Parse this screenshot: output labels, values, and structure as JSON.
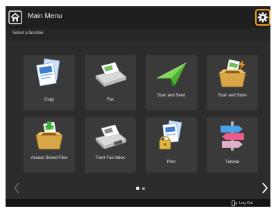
{
  "header": {
    "title": "Main Menu",
    "home_icon": "home-icon",
    "settings_icon": "gear-icon",
    "settings_highlight_color": "#f0a020"
  },
  "instruction": "Select a function.",
  "tiles": [
    {
      "label": "Copy",
      "icon": "copy-icon"
    },
    {
      "label": "Fax",
      "icon": "fax-icon"
    },
    {
      "label": "Scan and Send",
      "icon": "scan-and-send-icon"
    },
    {
      "label": "Scan and Store",
      "icon": "scan-and-store-icon"
    },
    {
      "label": "Access Stored Files",
      "icon": "access-stored-files-icon"
    },
    {
      "label": "Fax/I-Fax Inbox",
      "icon": "fax-inbox-icon"
    },
    {
      "label": "Print",
      "icon": "print-icon"
    },
    {
      "label": "Tutorial",
      "icon": "tutorial-icon"
    }
  ],
  "pager": {
    "current_page": 1,
    "total_pages": 2
  },
  "footer": {
    "logout_label": "Log Out",
    "logout_icon": "log-out-icon"
  }
}
